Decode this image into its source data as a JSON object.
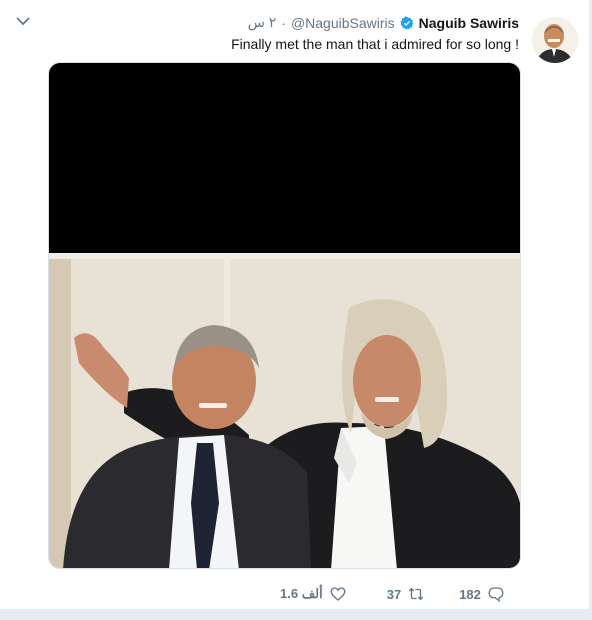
{
  "tweet": {
    "author": {
      "name": "Naguib Sawiris",
      "handle": "@NaguibSawiris",
      "verified": true,
      "avatar_icon": "avatar-photo"
    },
    "separator": "·",
    "time": "٢ س",
    "text": "Finally met the man that i admired for so long !",
    "menu_icon": "chevron-down-icon",
    "media": {
      "top_band_color": "#000000"
    },
    "actions": {
      "likes": "1.6 ألف",
      "retweets": "37",
      "replies": "182"
    }
  }
}
